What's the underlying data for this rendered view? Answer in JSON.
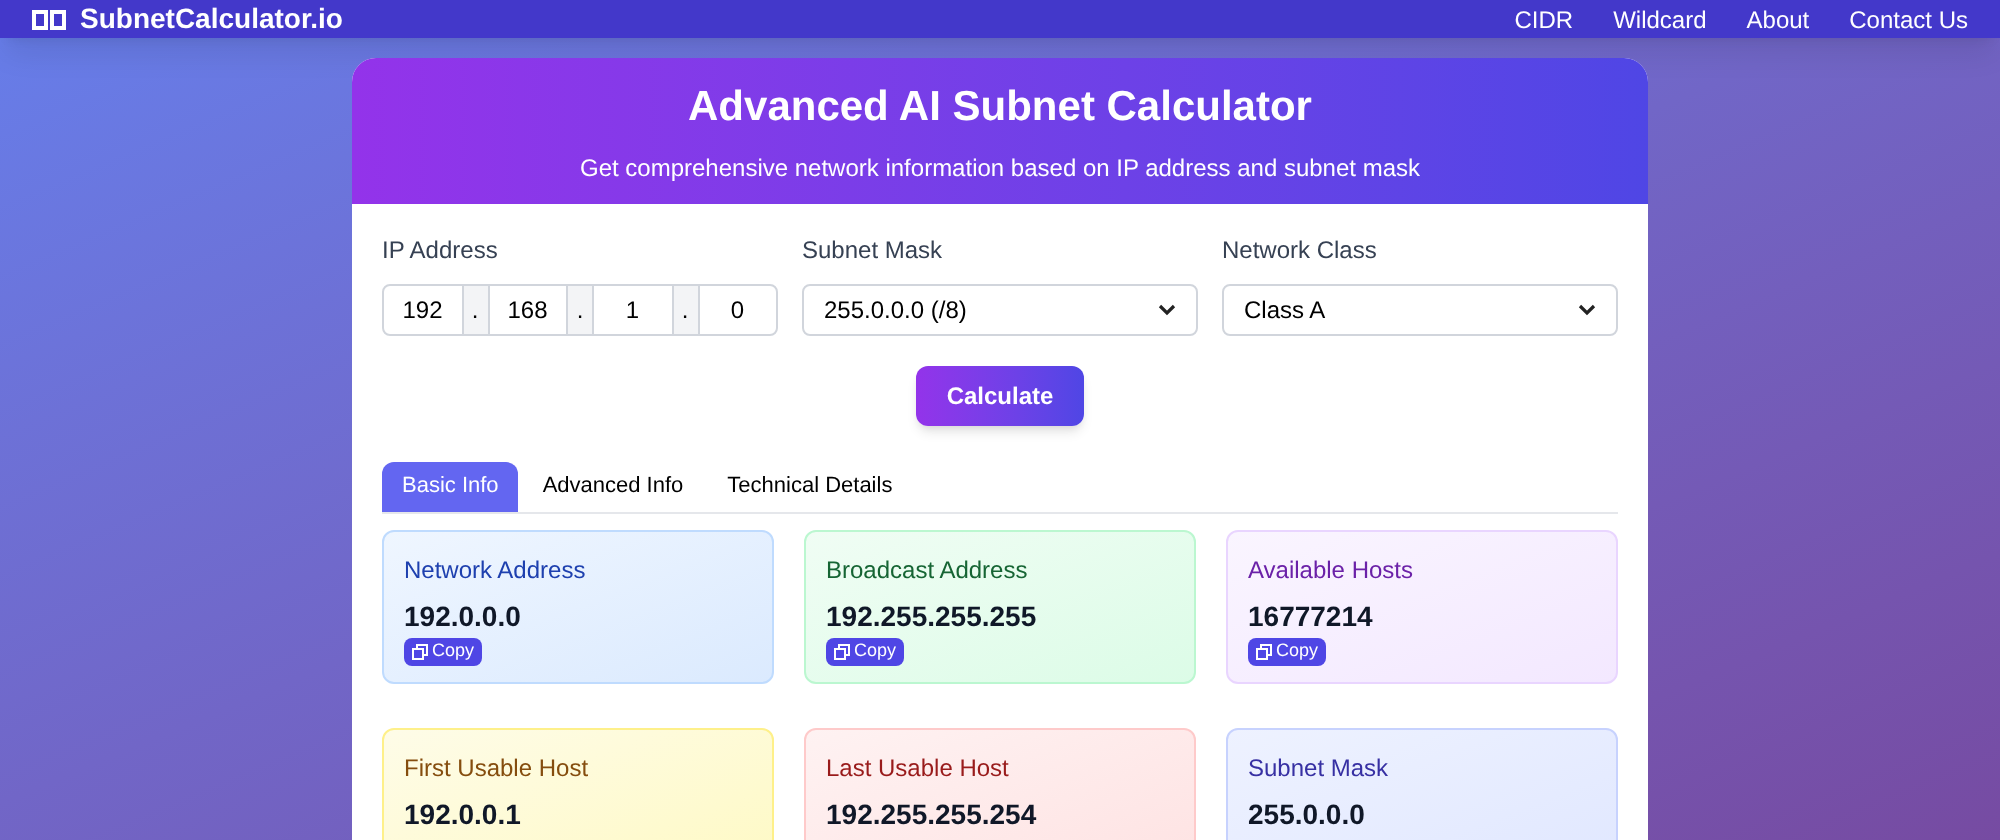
{
  "nav": {
    "brand": "SubnetCalculator.io",
    "links": [
      "CIDR",
      "Wildcard",
      "About",
      "Contact Us"
    ]
  },
  "header": {
    "title": "Advanced AI Subnet Calculator",
    "subtitle": "Get comprehensive network information based on IP address and subnet mask"
  },
  "form": {
    "ip_label": "IP Address",
    "octets": [
      "192",
      "168",
      "1",
      "0"
    ],
    "separator": ".",
    "mask_label": "Subnet Mask",
    "mask_value": "255.0.0.0 (/8)",
    "class_label": "Network Class",
    "class_value": "Class A",
    "calculate": "Calculate"
  },
  "tabs": [
    {
      "label": "Basic Info",
      "selected": true
    },
    {
      "label": "Advanced Info",
      "selected": false
    },
    {
      "label": "Technical Details",
      "selected": false
    }
  ],
  "cards": [
    {
      "title": "Network Address",
      "value": "192.0.0.0",
      "copy": "Copy",
      "color": "#1e40af"
    },
    {
      "title": "Broadcast Address",
      "value": "192.255.255.255",
      "copy": "Copy",
      "color": "#166534"
    },
    {
      "title": "Available Hosts",
      "value": "16777214",
      "copy": "Copy",
      "color": "#6b21a8"
    },
    {
      "title": "First Usable Host",
      "value": "192.0.0.1",
      "color": "#854d0e"
    },
    {
      "title": "Last Usable Host",
      "value": "192.255.255.254",
      "color": "#991b1b"
    },
    {
      "title": "Subnet Mask",
      "value": "255.0.0.0",
      "color": "#3730a3"
    }
  ]
}
